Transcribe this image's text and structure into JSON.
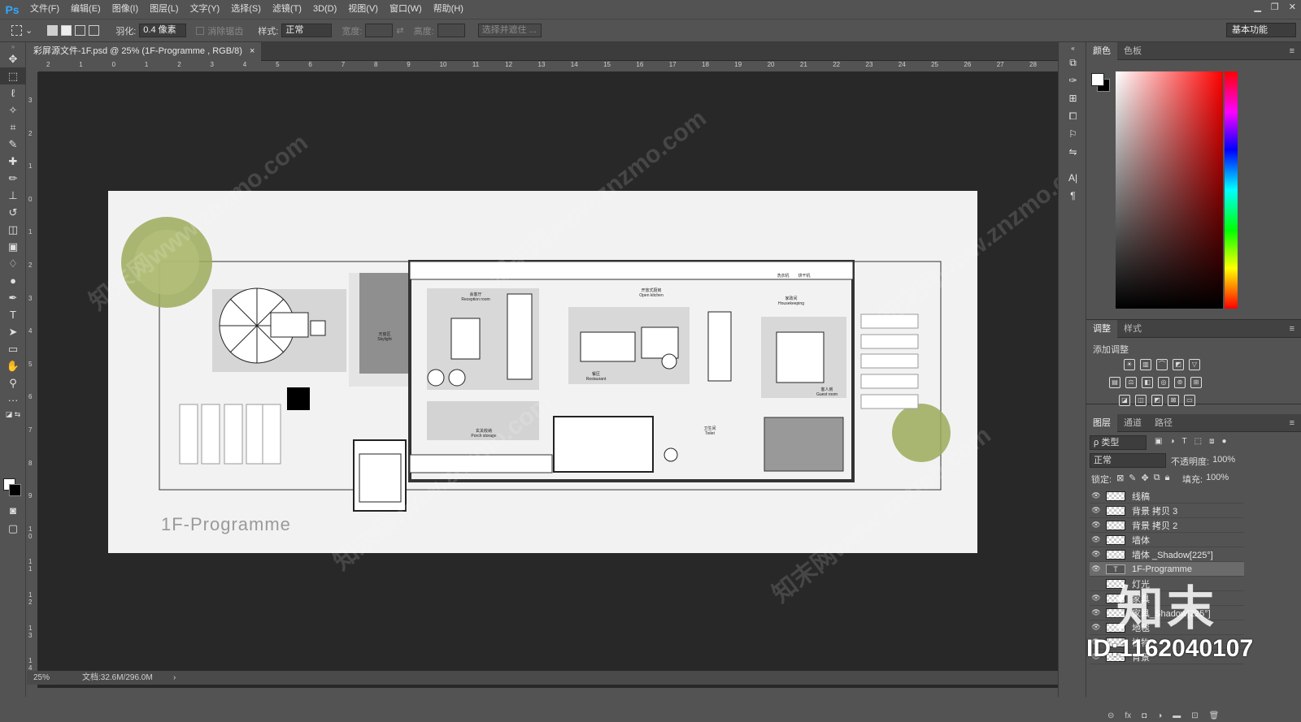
{
  "app": {
    "logo": "Ps"
  },
  "menu": [
    "文件(F)",
    "编辑(E)",
    "图像(I)",
    "图层(L)",
    "文字(Y)",
    "选择(S)",
    "滤镜(T)",
    "3D(D)",
    "视图(V)",
    "窗口(W)",
    "帮助(H)"
  ],
  "options": {
    "feather_label": "羽化:",
    "feather_value": "0.4 像素",
    "antialias_label": "消除锯齿",
    "style_label": "样式:",
    "style_value": "正常",
    "width_label": "宽度:",
    "height_label": "高度:",
    "select_mask": "选择并遮住 ...",
    "workspace": "基本功能"
  },
  "document": {
    "tab_title": "彩屏源文件-1F.psd @ 25% (1F-Programme , RGB/8)",
    "zoom": "25%",
    "doc_size": "文档:32.6M/296.0M",
    "plan_title": "1F-Programme",
    "ruler_h": [
      "2",
      "1",
      "0",
      "1",
      "2",
      "3",
      "4",
      "5",
      "6",
      "7",
      "8",
      "9",
      "10",
      "11",
      "12",
      "13",
      "14",
      "15",
      "16",
      "17",
      "18",
      "19",
      "20",
      "21",
      "22",
      "23",
      "24",
      "25",
      "26",
      "27",
      "28"
    ],
    "ruler_v": [
      "3",
      "2",
      "1",
      "0",
      "1",
      "2",
      "3",
      "4",
      "5",
      "6",
      "7",
      "8",
      "9",
      "1 0",
      "1 1",
      "1 2",
      "1 3",
      "1 4"
    ],
    "rooms": [
      {
        "label": "天窗区",
        "en": "Skylight"
      },
      {
        "label": "会客厅",
        "en": "Reception room"
      },
      {
        "label": "开放式厨房",
        "en": "Open kitchen"
      },
      {
        "label": "餐区",
        "en": "Restaurant"
      },
      {
        "label": "家政间",
        "en": "Housekeeping"
      },
      {
        "label": "客人房",
        "en": "Guest room"
      },
      {
        "label": "玄关收纳",
        "en": "Porch storage"
      },
      {
        "label": "卫生间",
        "en": "Toilet"
      }
    ],
    "kitchen_labels": [
      "洗衣机",
      "烘干机"
    ]
  },
  "panels": {
    "color_tabs": [
      "颜色",
      "色板"
    ],
    "adjust_tabs": [
      "调整",
      "样式"
    ],
    "adjust_title": "添加调整",
    "layer_tabs": [
      "图层",
      "通道",
      "路径"
    ],
    "filter": "ρ 类型",
    "blend": "正常",
    "opacity_label": "不透明度:",
    "opacity_value": "100%",
    "lock_label": "锁定:",
    "fill_label": "填充:",
    "fill_value": "100%",
    "layers": [
      "线稿",
      "背景 拷贝 3",
      "背景 拷贝 2",
      "墙体",
      "墙体 _Shadow[225°]",
      "1F-Programme",
      "灯光",
      "家具",
      "家具_Shadow[225°]",
      "地毯",
      "植物",
      "背景"
    ]
  },
  "watermark": {
    "text": "知末网www.znzmo.com",
    "logo": "知末",
    "id": "ID:1162040107"
  }
}
